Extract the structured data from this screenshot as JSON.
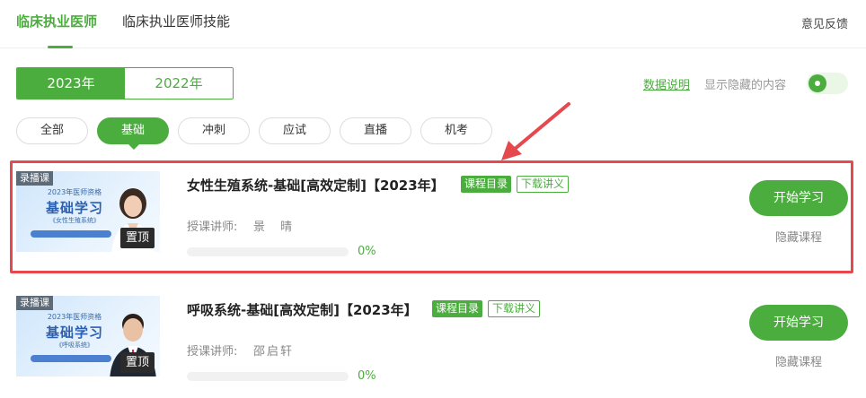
{
  "header": {
    "tabs": [
      {
        "label": "临床执业医师",
        "active": true
      },
      {
        "label": "临床执业医师技能",
        "active": false
      }
    ],
    "feedback_label": "意见反馈"
  },
  "years": {
    "items": [
      "2023年",
      "2022年"
    ],
    "selected": "2023年"
  },
  "options": {
    "data_link_label": "数据说明",
    "show_hidden_label": "显示隐藏的内容",
    "show_hidden_on": true
  },
  "filters": {
    "items": [
      "全部",
      "基础",
      "冲刺",
      "应试",
      "直播",
      "机考"
    ],
    "selected": "基础"
  },
  "colors": {
    "accent": "#4cad3f",
    "highlight": "#e5484d"
  },
  "courses": [
    {
      "thumb": {
        "badge": "录播课",
        "line1": "2023年医师资格",
        "line2": "基础学习",
        "line3": "《女性生殖系统》",
        "pin_label": "置顶"
      },
      "title": "女性生殖系统-基础[高效定制]【2023年】",
      "catalog_label": "课程目录",
      "download_label": "下载讲义",
      "teacher_label": "授课讲师:",
      "teacher_name": "景　晴",
      "progress": 0,
      "progress_text": "0%",
      "start_label": "开始学习",
      "hide_label": "隐藏课程"
    },
    {
      "thumb": {
        "badge": "录播课",
        "line1": "2023年医师资格",
        "line2": "基础学习",
        "line3": "《呼吸系统》",
        "pin_label": "置顶"
      },
      "title": "呼吸系统-基础[高效定制]【2023年】",
      "catalog_label": "课程目录",
      "download_label": "下载讲义",
      "teacher_label": "授课讲师:",
      "teacher_name": "邵启轩",
      "progress": 0,
      "progress_text": "0%",
      "start_label": "开始学习",
      "hide_label": "隐藏课程"
    }
  ]
}
